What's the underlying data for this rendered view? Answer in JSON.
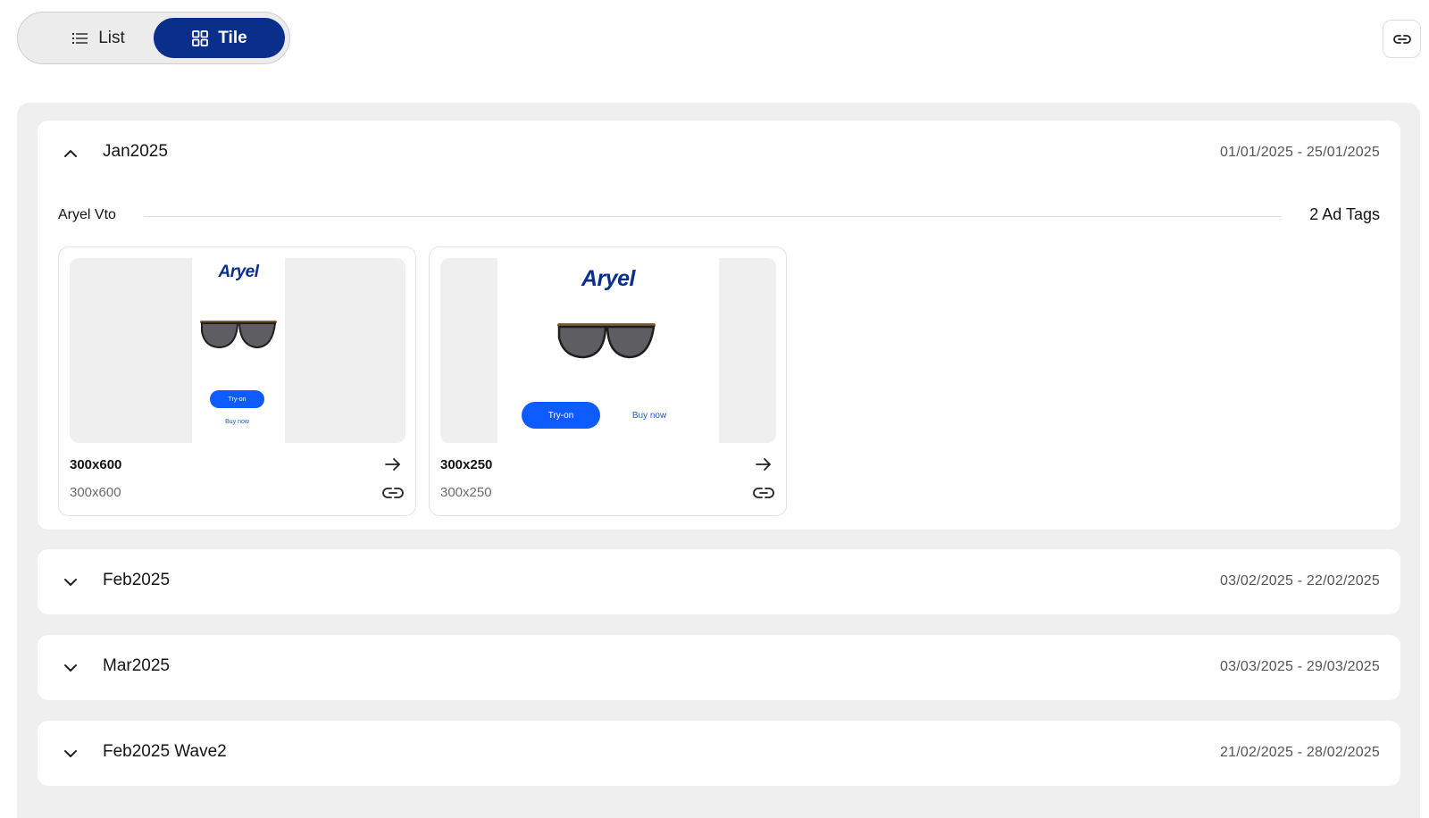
{
  "view_toggle": {
    "list_label": "List",
    "tile_label": "Tile",
    "active": "Tile",
    "active_color": "#0a2f8a"
  },
  "top_actions": {
    "link_icon": "link-icon"
  },
  "months": [
    {
      "title": "Jan2025",
      "dates": "01/01/2025 - 25/01/2025",
      "expanded": true,
      "group": {
        "name": "Aryel Vto",
        "count_label": "2 Ad Tags",
        "ads": [
          {
            "title": "300x600",
            "subtitle": "300x600",
            "creative": {
              "logo": "Aryel",
              "try_label": "Try-on",
              "buy_label": "Buy now"
            }
          },
          {
            "title": "300x250",
            "subtitle": "300x250",
            "creative": {
              "logo": "Aryel",
              "try_label": "Try-on",
              "buy_label": "Buy now"
            }
          }
        ]
      }
    },
    {
      "title": "Feb2025",
      "dates": "03/02/2025 - 22/02/2025",
      "expanded": false
    },
    {
      "title": "Mar2025",
      "dates": "03/03/2025 - 29/03/2025",
      "expanded": false
    },
    {
      "title": "Feb2025 Wave2",
      "dates": "21/02/2025 - 28/02/2025",
      "expanded": false
    }
  ],
  "colors": {
    "brand": "#0a2f8a",
    "cta": "#0e5cff",
    "panel_bg": "#efefef"
  }
}
